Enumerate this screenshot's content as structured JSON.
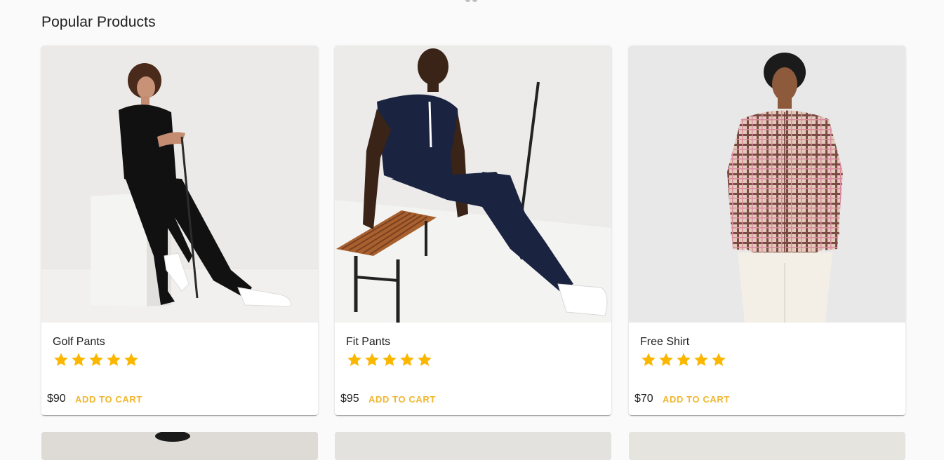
{
  "section": {
    "title": "Popular Products"
  },
  "colors": {
    "star": "#fbb700",
    "add_to_cart": "#f0b62e",
    "background": "#fafafa"
  },
  "products": [
    {
      "name": "Golf Pants",
      "rating": 5,
      "price": "$90",
      "cta": "ADD TO CART",
      "image": "man-in-black-polo-with-golf-club"
    },
    {
      "name": "Fit Pants",
      "rating": 5,
      "price": "$95",
      "cta": "ADD TO CART",
      "image": "man-in-navy-polo-on-bench"
    },
    {
      "name": "Free Shirt",
      "rating": 5,
      "price": "$70",
      "cta": "ADD TO CART",
      "image": "man-in-plaid-shirt"
    }
  ]
}
